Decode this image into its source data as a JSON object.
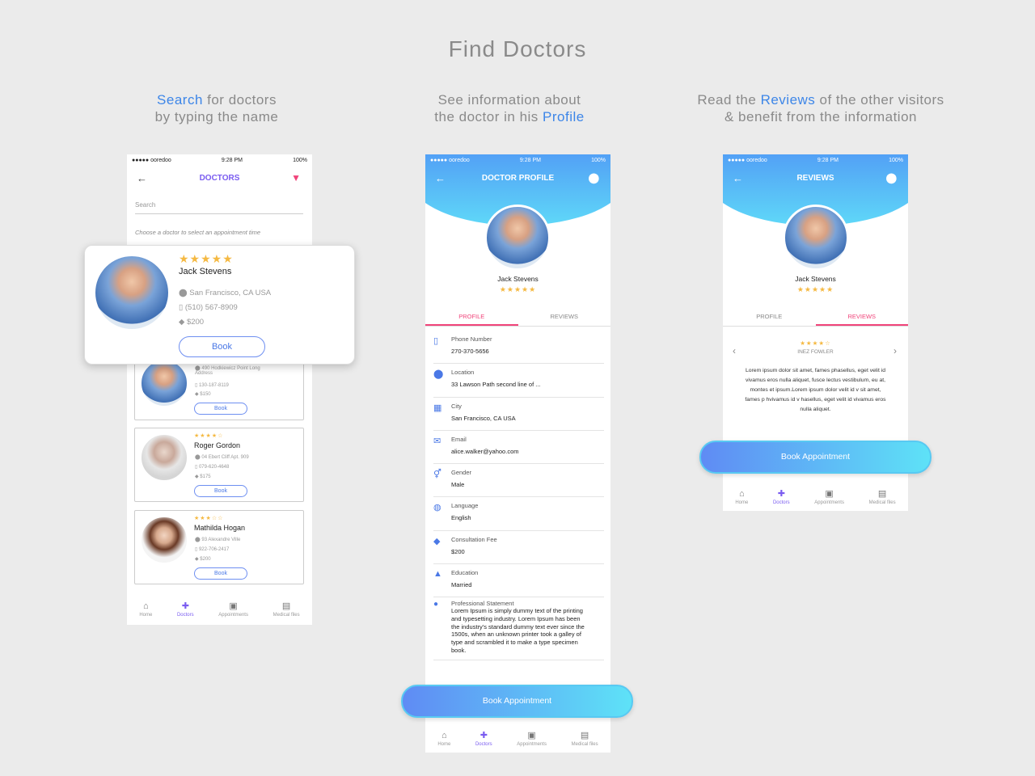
{
  "title": "Find Doctors",
  "captions": {
    "c1": {
      "hl": "Search",
      "rest1": " for doctors",
      "line2": "by typing the name"
    },
    "c2": {
      "line1": "See information about",
      "pre": "the doctor in his ",
      "hl": "Profile"
    },
    "c3": {
      "pre": "Read the ",
      "hl": "Reviews",
      "post": " of the other visitors",
      "line2": "& benefit from the information"
    }
  },
  "status": {
    "carrier": "●●●●● ooredoo",
    "time": "9:28 PM",
    "battery": "100%"
  },
  "tabbar": {
    "home": "Home",
    "doctors": "Doctors",
    "appointments": "Appointments",
    "files": "Medical files"
  },
  "screen1": {
    "title": "DOCTORS",
    "search_placeholder": "Search",
    "hint": "Choose a doctor to select an appointment time",
    "featured": {
      "stars": "★★★★★",
      "name": "Jack Stevens",
      "address": "San Francisco, CA USA",
      "phone": "(510) 567-8909",
      "fee": "$200",
      "book": "Book"
    },
    "partial": {
      "address": "490 Hodkiewicz Point Long Address",
      "phone": "130-187-8119",
      "fee": "$150",
      "book": "Book"
    },
    "doctors": [
      {
        "stars": "★★★★☆",
        "name": "Roger Gordon",
        "address": "04 Ebert Cliff Apt. 909",
        "phone": "079-620-4648",
        "fee": "$175",
        "book": "Book"
      },
      {
        "stars": "★★★☆☆",
        "name": "Mathilda Hogan",
        "address": "93 Alexandre Ville",
        "phone": "922-706-2417",
        "fee": "$200",
        "book": "Book"
      }
    ]
  },
  "screen2": {
    "title": "DOCTOR PROFILE",
    "name": "Jack Stevens",
    "stars": "★★★★★",
    "tab_profile": "PROFILE",
    "tab_reviews": "REVIEWS",
    "fields": [
      {
        "icon": "phone-icon",
        "glyph": "▯",
        "label": "Phone Number",
        "value": "270-370-5656"
      },
      {
        "icon": "location-icon",
        "glyph": "⬤",
        "label": "Location",
        "value": "33 Lawson Path second line of ..."
      },
      {
        "icon": "city-icon",
        "glyph": "▦",
        "label": "City",
        "value": "San Francisco, CA USA"
      },
      {
        "icon": "email-icon",
        "glyph": "✉",
        "label": "Email",
        "value": "alice.walker@yahoo.com"
      },
      {
        "icon": "gender-icon",
        "glyph": "⚥",
        "label": "Gender",
        "value": "Male"
      },
      {
        "icon": "globe-icon",
        "glyph": "◍",
        "label": "Language",
        "value": "English"
      },
      {
        "icon": "tag-icon",
        "glyph": "◆",
        "label": "Consultation Fee",
        "value": "$200"
      },
      {
        "icon": "education-icon",
        "glyph": "▲",
        "label": "Education",
        "value": "Married"
      }
    ],
    "statement_label": "Professional Statement",
    "statement": "Lorem Ipsum is simply dummy text of the printing and typesetting industry. Lorem Ipsum has been the industry's standard dummy text ever since the 1500s, when an unknown printer took a galley of type and scrambled it to make a type specimen book.",
    "book": "Book Appointment"
  },
  "screen3": {
    "title": "REVIEWS",
    "name": "Jack Stevens",
    "stars": "★★★★★",
    "tab_profile": "PROFILE",
    "tab_reviews": "REVIEWS",
    "review_stars": "★★★★☆",
    "reviewer": "INEZ FOWLER",
    "review": "Lorem ipsum dolor sit amet, fames phasellus, eget velit id vivamus eros nulla aliquet, fusce lectus vestibulum, eu at, montes et ipsum.Lorem ipsum dolor velit id v sit amet, fames p hvivamus id v hasellus, eget velit id vivamus eros nulla aliquet.",
    "book": "Book Appointment"
  }
}
